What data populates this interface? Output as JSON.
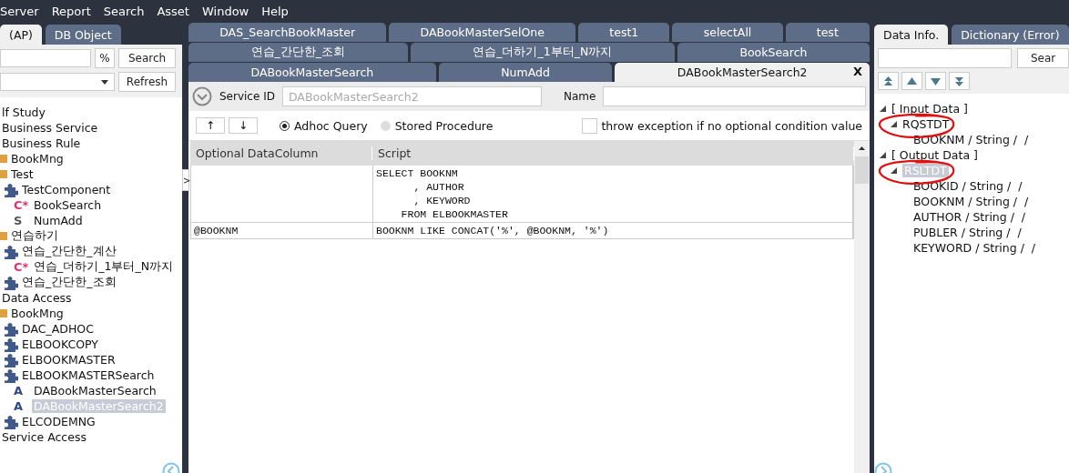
{
  "menu": [
    "Server",
    "Report",
    "Search",
    "Asset",
    "Window",
    "Help"
  ],
  "left_panel": {
    "tabs": [
      {
        "label": "(AP)",
        "selected": true
      },
      {
        "label": "DB Object",
        "selected": false
      }
    ],
    "percent_button": "%",
    "search_button": "Search",
    "refresh_button": "Refresh",
    "splitter_label": ">",
    "tree": [
      {
        "label": "lf Study",
        "selected": false
      },
      {
        "label": "Business Service",
        "selected": false
      },
      {
        "label": "Business Rule",
        "selected": false,
        "children": [
          {
            "label": "BookMng",
            "kind": "folder",
            "selected": false
          },
          {
            "label": "Test",
            "kind": "folder",
            "selected": false,
            "children": [
              {
                "label": "TestComponent",
                "kind": "component",
                "selected": false,
                "children": [
                  {
                    "label": "BookSearch",
                    "kind": "class",
                    "badge": "C*",
                    "selected": false
                  },
                  {
                    "label": "NumAdd",
                    "kind": "static",
                    "badge": "S",
                    "selected": false
                  }
                ]
              }
            ]
          },
          {
            "label": "연습하기",
            "kind": "folder",
            "selected": false,
            "children": [
              {
                "label": "연습_간단한_계산",
                "kind": "component",
                "selected": false,
                "children": [
                  {
                    "label": "연습_더하기_1부터_N까지",
                    "kind": "class",
                    "badge": "C*",
                    "selected": false
                  }
                ]
              },
              {
                "label": "연습_간단한_조회",
                "kind": "component",
                "selected": false
              }
            ]
          }
        ]
      },
      {
        "label": "Data Access",
        "selected": false,
        "children": [
          {
            "label": "BookMng",
            "kind": "folder",
            "selected": false,
            "children": [
              {
                "label": "DAC_ADHOC",
                "kind": "component",
                "selected": false
              },
              {
                "label": "ELBOOKCOPY",
                "kind": "component",
                "selected": false
              },
              {
                "label": "ELBOOKMASTER",
                "kind": "component",
                "selected": false
              },
              {
                "label": "ELBOOKMASTERSearch",
                "kind": "component",
                "selected": false,
                "children": [
                  {
                    "label": "DABookMasterSearch",
                    "kind": "access",
                    "badge": "A",
                    "selected": false
                  },
                  {
                    "label": "DABookMasterSearch2",
                    "kind": "access",
                    "badge": "A",
                    "selected": true
                  }
                ]
              },
              {
                "label": "ELCODEMNG",
                "kind": "component",
                "selected": false
              }
            ]
          }
        ]
      },
      {
        "label": "Service Access",
        "selected": false
      }
    ]
  },
  "center": {
    "tab_rows": [
      [
        {
          "label": "DAS_SearchBookMaster",
          "selected": false
        },
        {
          "label": "DABookMasterSelOne",
          "selected": false
        },
        {
          "label": "test1",
          "selected": false
        },
        {
          "label": "selectAll",
          "selected": false
        },
        {
          "label": "test",
          "selected": false
        }
      ],
      [
        {
          "label": "연습_간단한_조회",
          "selected": false
        },
        {
          "label": "연습_더하기_1부터_N까지",
          "selected": false
        },
        {
          "label": "BookSearch",
          "selected": false
        }
      ],
      [
        {
          "label": "DABookMasterSearch",
          "selected": false
        },
        {
          "label": "NumAdd",
          "selected": false
        },
        {
          "label": "DABookMasterSearch2",
          "selected": true
        }
      ]
    ],
    "tab_close": "X",
    "service_id_label": "Service ID",
    "service_id": "DABookMasterSearch2",
    "name_label": "Name",
    "up_button": "↑",
    "down_button": "↓",
    "radios": [
      {
        "label": "Adhoc Query",
        "selected": true
      },
      {
        "label": "Stored Procedure",
        "selected": false
      }
    ],
    "exception_checkbox": {
      "label": "throw exception if no optional condition value",
      "checked": false
    },
    "table": {
      "columns": [
        "Optional DataColumn",
        "Script"
      ],
      "rows": [
        [
          "",
          "SELECT BOOKNM\n      , AUTHOR\n      , KEYWORD\n    FROM ELBOOKMASTER"
        ],
        [
          "@BOOKNM",
          "BOOKNM LIKE CONCAT('%', @BOOKNM, '%')"
        ]
      ]
    }
  },
  "right_panel": {
    "tabs": [
      {
        "label": "Data Info.",
        "selected": true
      },
      {
        "label": "Dictionary (Error)",
        "selected": false
      }
    ],
    "search_button": "Sear",
    "tree": [
      {
        "label": "[ Input Data ]",
        "expanded": true,
        "selected": false,
        "children": [
          {
            "label": "RQSTDT",
            "expanded": true,
            "selected": false,
            "circled": true,
            "children": [
              {
                "label": "BOOKNM / String /  /",
                "selected": false
              }
            ]
          }
        ]
      },
      {
        "label": "[ Output Data ]",
        "expanded": true,
        "selected": false,
        "children": [
          {
            "label": "RSLTDT",
            "expanded": true,
            "selected": true,
            "circled": true,
            "children": [
              {
                "label": "BOOKID / String /  /",
                "selected": false
              },
              {
                "label": "BOOKNM / String /  /",
                "selected": false
              },
              {
                "label": "AUTHOR / String /  /",
                "selected": false
              },
              {
                "label": "PUBLER / String /  /",
                "selected": false
              },
              {
                "label": "KEYWORD / String /  /",
                "selected": false
              }
            ]
          }
        ]
      }
    ]
  }
}
